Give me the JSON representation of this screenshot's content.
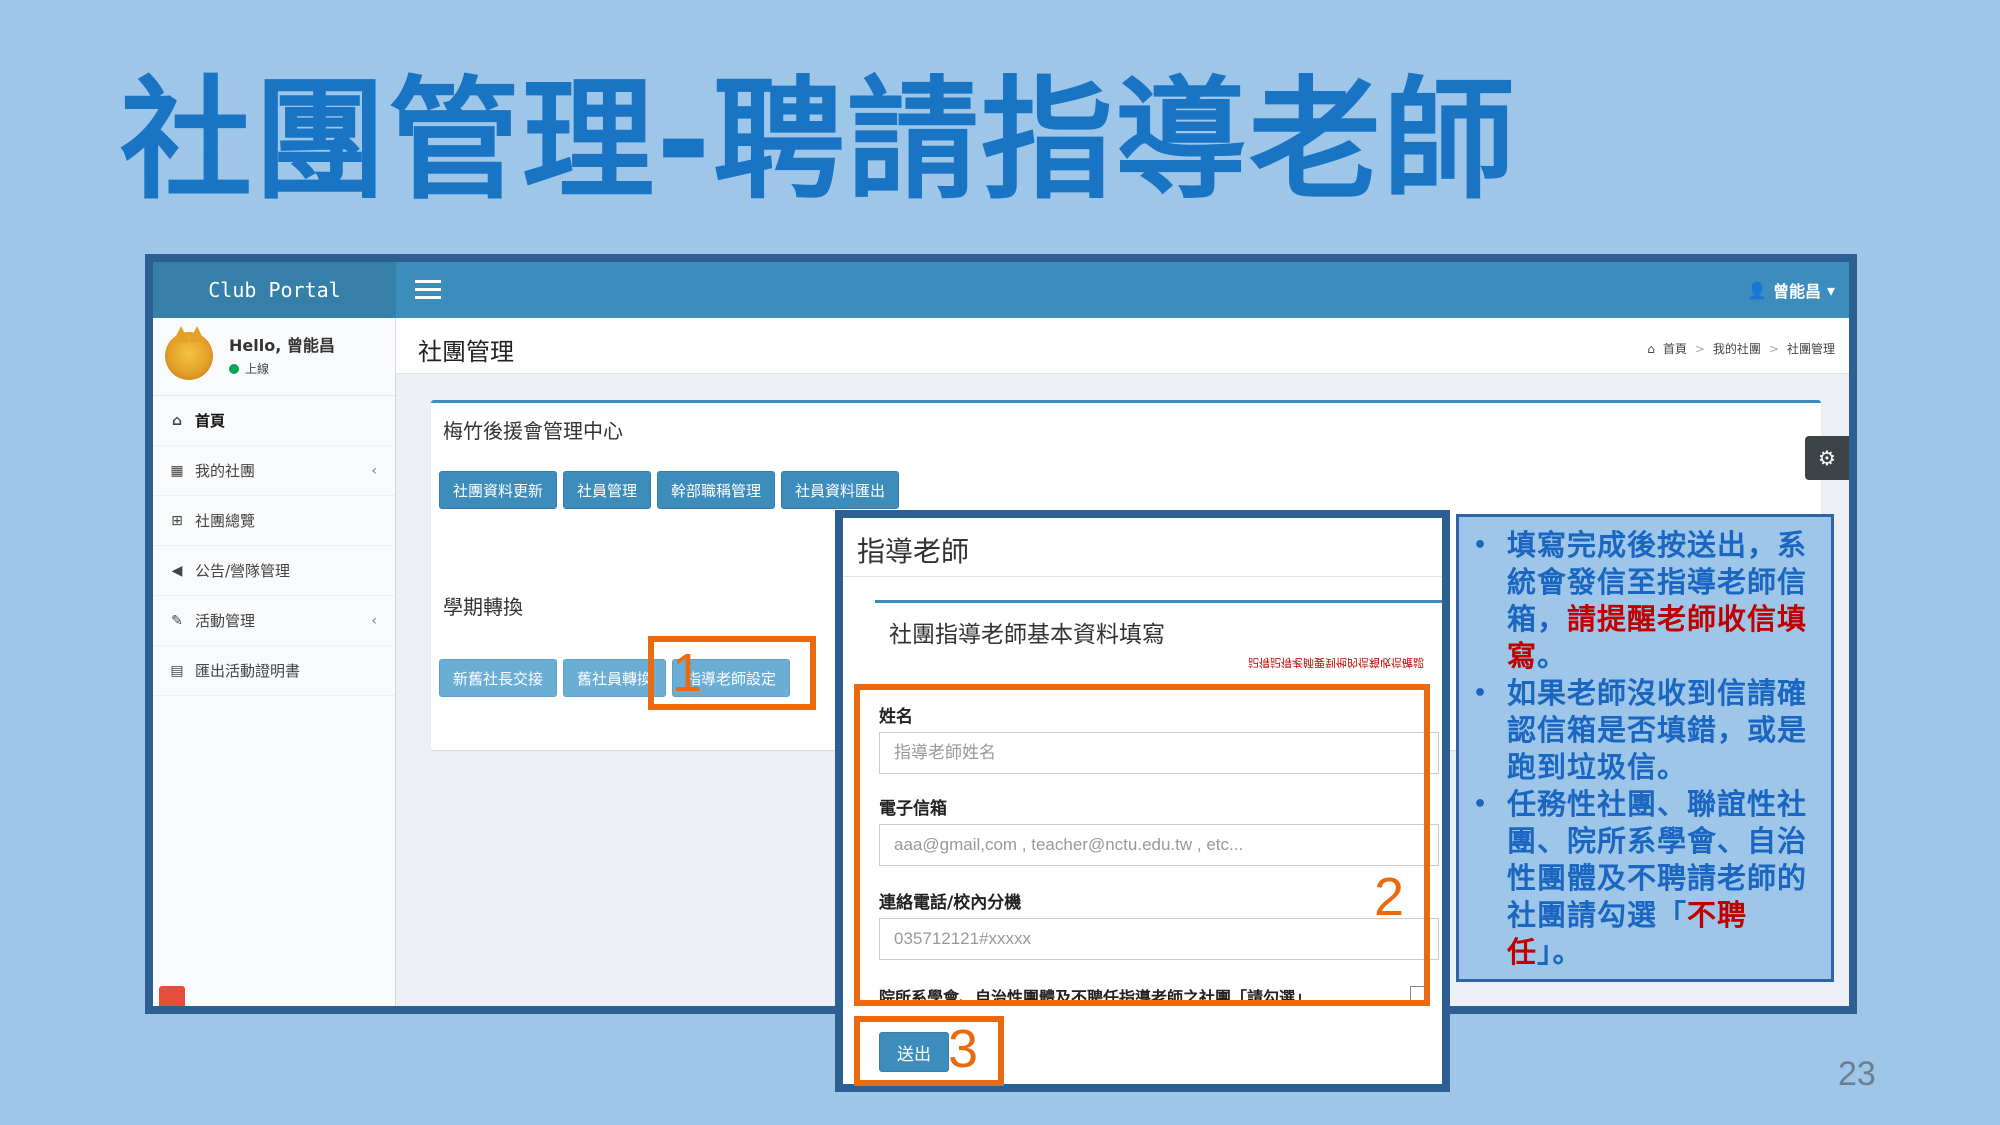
{
  "slide": {
    "title": "社團管理-聘請指導老師",
    "page_number": "23"
  },
  "app": {
    "logo": "Club Portal",
    "user_name": "曾能昌",
    "user_caret": "▾"
  },
  "sidebar": {
    "hello": "Hello, 曾能昌",
    "status": "上線",
    "items": [
      {
        "label": "首頁",
        "icon": "home-icon"
      },
      {
        "label": "我的社團",
        "icon": "grid-icon",
        "chevron": "‹"
      },
      {
        "label": "社團總覽",
        "icon": "table-icon"
      },
      {
        "label": "公告/營隊管理",
        "icon": "bullhorn-icon"
      },
      {
        "label": "活動管理",
        "icon": "edit-icon",
        "chevron": "‹"
      },
      {
        "label": "匯出活動證明書",
        "icon": "document-icon"
      }
    ]
  },
  "header": {
    "title": "社團管理",
    "breadcrumb": [
      "首頁",
      "我的社團",
      "社團管理"
    ],
    "breadcrumb_sep": ">"
  },
  "main": {
    "box_title": "梅竹後援會管理中心",
    "buttons_row1": [
      "社團資料更新",
      "社員管理",
      "幹部職稱管理",
      "社員資料匯出"
    ],
    "section_title": "學期轉換",
    "buttons_row2": [
      "新舊社長交接",
      "舊社員轉換",
      "指導老師設定"
    ]
  },
  "callouts": [
    "1",
    "2",
    "3"
  ],
  "modal": {
    "title": "指導老師",
    "form_title": "社團指導老師基本資料填寫",
    "note": "記得記得老師要到他的信箱收信確認",
    "fields": [
      {
        "label": "姓名",
        "placeholder": "指導老師姓名"
      },
      {
        "label": "電子信箱",
        "placeholder": "aaa@gmail,com , teacher@nctu.edu.tw , etc..."
      },
      {
        "label": "連絡電話/校內分機",
        "placeholder": "035712121#xxxxx"
      }
    ],
    "checkbox_label": "院所系學會、自治性團體及不聘任指導老師之社團「請勾選」",
    "submit": "送出"
  },
  "notes": {
    "bullet": "•",
    "item1_a": "填寫完成後按送出，系統會發信至指導老師信箱，",
    "item1_red": "請提醒老師收信填寫",
    "item1_b": "。",
    "item2": "如果老師沒收到信請確認信箱是否填錯，或是跑到垃圾信。",
    "item3_a": "任務性社團、聯誼性社團、院所系學會、自治性團體及不聘請老師的社團請勾選「",
    "item3_red": "不聘任",
    "item3_b": "」。"
  },
  "colors": {
    "slide_bg": "#9dc6e8",
    "title_blue": "#1a74c4",
    "topbar": "#3c8dbc",
    "callout_orange": "#ea6a10",
    "frame_blue": "#2e5f92",
    "emphasis_red": "#c00000"
  }
}
